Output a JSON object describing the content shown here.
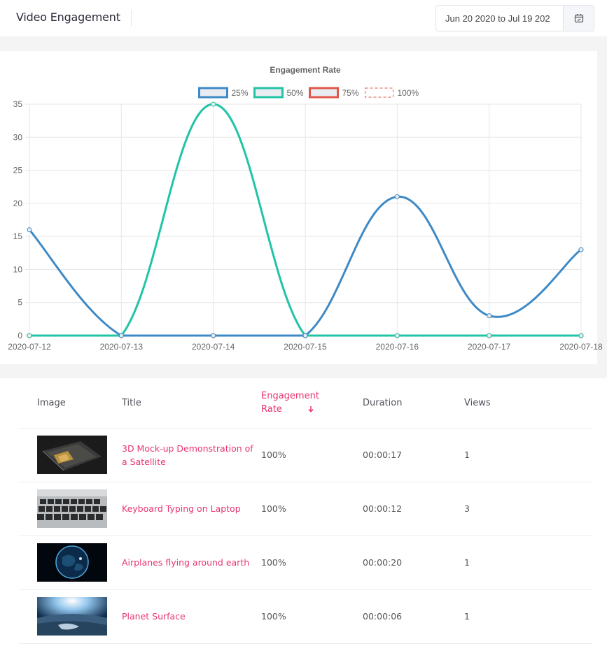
{
  "header": {
    "title": "Video Engagement",
    "date_range_value": "Jun 20 2020 to Jul 19 202",
    "calendar_icon": "calendar-icon"
  },
  "chart_data": {
    "type": "line",
    "title": "Engagement Rate",
    "x": [
      "2020-07-12",
      "2020-07-13",
      "2020-07-14",
      "2020-07-15",
      "2020-07-16",
      "2020-07-17",
      "2020-07-18"
    ],
    "ylim": [
      0,
      35
    ],
    "yticks": [
      0,
      5,
      10,
      15,
      20,
      25,
      30,
      35
    ],
    "grid": true,
    "legend_position": "top",
    "series": [
      {
        "name": "25%",
        "values": [
          16,
          0,
          0,
          0,
          21,
          3,
          13
        ],
        "color": "#3e8ac6",
        "fill": "#e9edf2",
        "dashed": false
      },
      {
        "name": "50%",
        "values": [
          0,
          0,
          35,
          0,
          0,
          0,
          0
        ],
        "color": "#22c4a6",
        "fill": "#e9edf2",
        "dashed": false
      },
      {
        "name": "75%",
        "values": [
          0,
          0,
          0,
          0,
          0,
          0,
          0
        ],
        "color": "#e0584a",
        "fill": "#e9edf2",
        "dashed": false
      },
      {
        "name": "100%",
        "values": [
          0,
          0,
          0,
          0,
          0,
          0,
          0
        ],
        "color": "#e0584a",
        "fill": "#ffffff",
        "dashed": true
      }
    ]
  },
  "table": {
    "columns": {
      "image": "Image",
      "title": "Title",
      "engagement_rate": "Engagement Rate",
      "duration": "Duration",
      "views": "Views"
    },
    "sort_icon": "arrow-down-icon",
    "rows": [
      {
        "title": "3D Mock-up Demonstration of a Satellite",
        "engagement_rate": "100%",
        "duration": "00:00:17",
        "views": "1",
        "thumbnail": "satellite"
      },
      {
        "title": "Keyboard Typing on Laptop",
        "engagement_rate": "100%",
        "duration": "00:00:12",
        "views": "3",
        "thumbnail": "keyboard"
      },
      {
        "title": "Airplanes flying around earth",
        "engagement_rate": "100%",
        "duration": "00:00:20",
        "views": "1",
        "thumbnail": "earth"
      },
      {
        "title": "Planet Surface",
        "engagement_rate": "100%",
        "duration": "00:00:06",
        "views": "1",
        "thumbnail": "planet"
      }
    ]
  }
}
